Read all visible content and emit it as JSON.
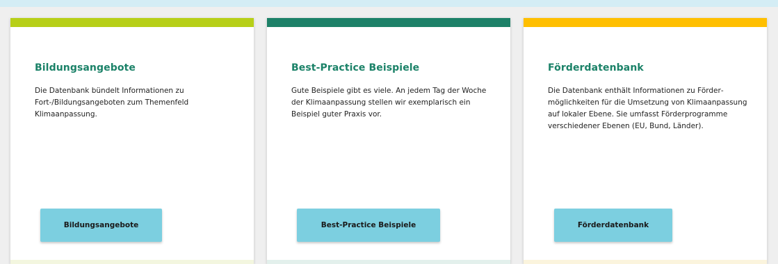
{
  "cards": [
    {
      "accent_color": "#b7cf18",
      "footer_color": "#f3f6df",
      "title": "Bildungsangebote",
      "description": "Die Datenbank bündelt Informationen zu Fort-/Bildungsangeboten zum Themenfeld Klimaanpassung.",
      "button_label": "Bildungsangebote"
    },
    {
      "accent_color": "#1d8168",
      "footer_color": "#e3f0ec",
      "title": "Best-Practice Beispiele",
      "description": "Gute Beispiele gibt es viele. An jedem Tag der Woche der Klimaanpassung stellen wir ex­emplarisch ein Beispiel guter Praxis vor.",
      "button_label": "Best-Practice Beispiele"
    },
    {
      "accent_color": "#ffbf00",
      "footer_color": "#fbf4dd",
      "title": "Förderdatenbank",
      "description": "Die Datenbank enthält Informationen zu Förder­möglichkeiten für die Umsetzung von Kli­maanpassung auf lokaler Ebene. Sie umfasst Förderprogramme verschiedener Ebenen (EU, Bund, Länder).",
      "button_label": "Förderdatenbank"
    }
  ]
}
